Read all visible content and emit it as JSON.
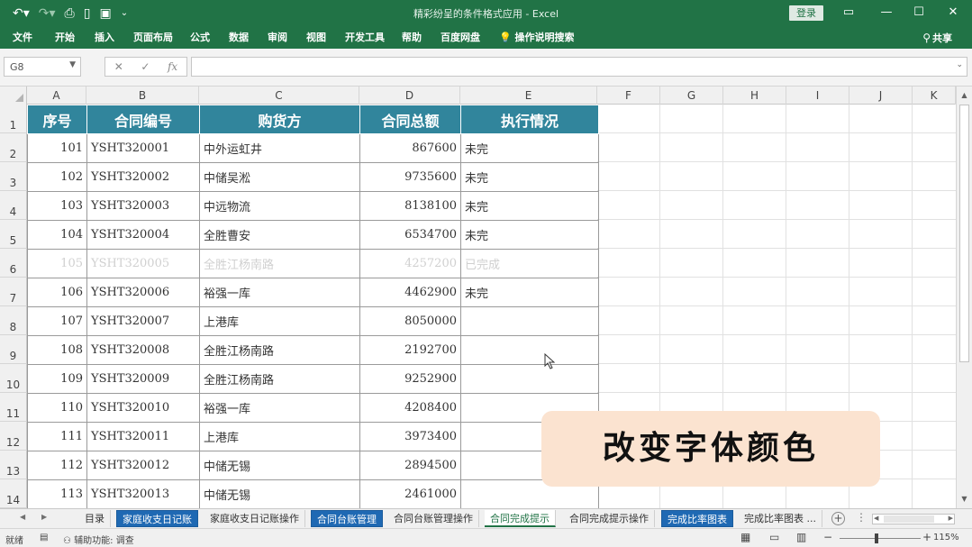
{
  "title_bar": {
    "doc_title": "精彩纷呈的条件格式应用 - Excel",
    "login_label": "登录",
    "icons": [
      "undo-icon",
      "redo-icon",
      "print-preview-icon",
      "new-file-icon",
      "save-icon",
      "customize-qat-icon",
      "ribbon-display-icon",
      "minimize-icon",
      "maximize-icon",
      "close-icon"
    ]
  },
  "ribbon": {
    "tabs": [
      "文件",
      "开始",
      "插入",
      "页面布局",
      "公式",
      "数据",
      "审阅",
      "视图",
      "开发工具",
      "帮助",
      "百度网盘",
      "操作说明搜索"
    ],
    "share_label": "共享"
  },
  "formula_bar": {
    "name_box": "G8",
    "fx_label": "fx",
    "value": ""
  },
  "grid": {
    "columns": [
      "A",
      "B",
      "C",
      "D",
      "E",
      "F",
      "G",
      "H",
      "I",
      "J",
      "K"
    ],
    "rows": [
      "1",
      "2",
      "3",
      "4",
      "5",
      "6",
      "7",
      "8",
      "9",
      "10",
      "11",
      "12",
      "13",
      "14"
    ]
  },
  "table": {
    "headers": [
      "序号",
      "合同编号",
      "购货方",
      "合同总额",
      "执行情况"
    ],
    "rows": [
      {
        "no": "101",
        "code": "YSHT320001",
        "buyer": "中外运虹井",
        "amount": "867600",
        "status": "未完"
      },
      {
        "no": "102",
        "code": "YSHT320002",
        "buyer": "中储吴淞",
        "amount": "9735600",
        "status": "未完"
      },
      {
        "no": "103",
        "code": "YSHT320003",
        "buyer": "中远物流",
        "amount": "8138100",
        "status": "未完"
      },
      {
        "no": "104",
        "code": "YSHT320004",
        "buyer": "全胜曹安",
        "amount": "6534700",
        "status": "未完"
      },
      {
        "no": "105",
        "code": "YSHT320005",
        "buyer": "全胜江杨南路",
        "amount": "4257200",
        "status": "已完成"
      },
      {
        "no": "106",
        "code": "YSHT320006",
        "buyer": "裕强一库",
        "amount": "4462900",
        "status": "未完"
      },
      {
        "no": "107",
        "code": "YSHT320007",
        "buyer": "上港库",
        "amount": "8050000",
        "status": ""
      },
      {
        "no": "108",
        "code": "YSHT320008",
        "buyer": "全胜江杨南路",
        "amount": "2192700",
        "status": ""
      },
      {
        "no": "109",
        "code": "YSHT320009",
        "buyer": "全胜江杨南路",
        "amount": "9252900",
        "status": ""
      },
      {
        "no": "110",
        "code": "YSHT320010",
        "buyer": "裕强一库",
        "amount": "4208400",
        "status": ""
      },
      {
        "no": "111",
        "code": "YSHT320011",
        "buyer": "上港库",
        "amount": "3973400",
        "status": ""
      },
      {
        "no": "112",
        "code": "YSHT320012",
        "buyer": "中储无锡",
        "amount": "2894500",
        "status": ""
      },
      {
        "no": "113",
        "code": "YSHT320013",
        "buyer": "中储无锡",
        "amount": "2461000",
        "status": ""
      }
    ],
    "header_color": "#31859c",
    "completed_text_color": "#d0d0d0"
  },
  "caption": "改变字体颜色",
  "sheet_tabs": [
    {
      "label": "目录",
      "style": "normal"
    },
    {
      "label": "家庭收支日记账",
      "style": "blue"
    },
    {
      "label": "家庭收支日记账操作",
      "style": "normal"
    },
    {
      "label": "合同台账管理",
      "style": "blue"
    },
    {
      "label": "合同台账管理操作",
      "style": "normal"
    },
    {
      "label": "合同完成提示",
      "style": "active"
    },
    {
      "label": "合同完成提示操作",
      "style": "normal"
    },
    {
      "label": "完成比率图表",
      "style": "blue"
    },
    {
      "label": "完成比率图表 ...",
      "style": "normal"
    }
  ],
  "status_bar": {
    "mode": "就绪",
    "accessibility": "辅助功能: 调查",
    "zoom": "115%"
  }
}
